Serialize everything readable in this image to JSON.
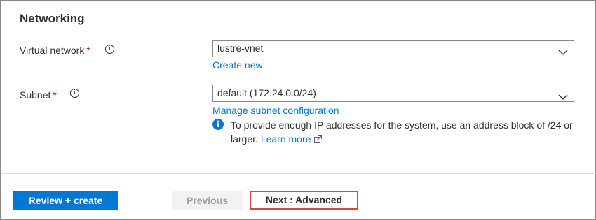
{
  "section": {
    "title": "Networking"
  },
  "fields": {
    "vnet": {
      "label": "Virtual network",
      "required": "*",
      "info_icon": "info-icon",
      "value": "lustre-vnet",
      "link": "Create new"
    },
    "subnet": {
      "label": "Subnet",
      "required": "*",
      "info_icon": "info-icon",
      "value": "default (172.24.0.0/24)",
      "link": "Manage subnet configuration"
    }
  },
  "note": {
    "icon": "info-filled-icon",
    "text": "To provide enough IP addresses for the system, use an address block of /24 or larger.",
    "link": "Learn more",
    "link_icon": "external-link-icon"
  },
  "footer": {
    "review_create": "Review + create",
    "previous": "Previous",
    "next": "Next : Advanced"
  },
  "colors": {
    "accent": "#0078d4",
    "required": "#a4262c",
    "highlight_border": "#e04343"
  }
}
